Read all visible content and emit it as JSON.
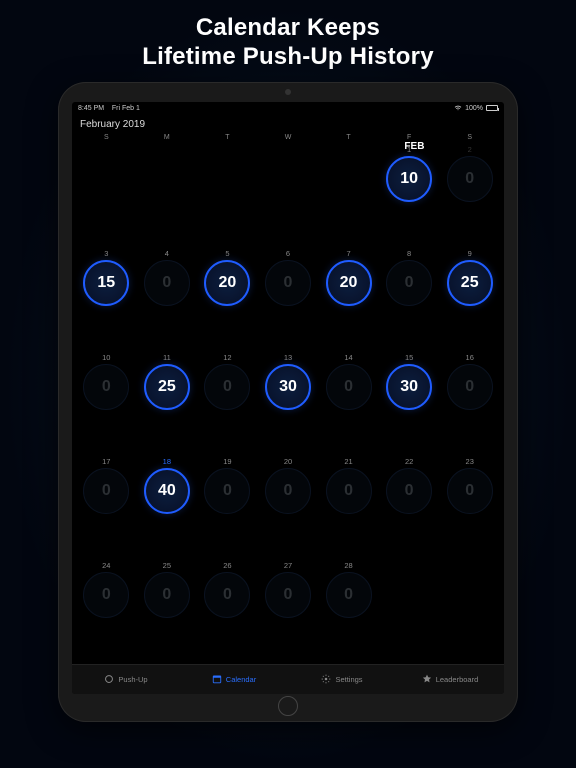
{
  "headline": {
    "line1": "Calendar Keeps",
    "line2": "Lifetime Push-Up History"
  },
  "statusbar": {
    "time": "8:45 PM",
    "date": "Fri Feb 1",
    "battery": "100%"
  },
  "month_title": "February 2019",
  "weekdays": [
    "S",
    "M",
    "T",
    "W",
    "T",
    "F",
    "S"
  ],
  "month_badge": "FEB",
  "today_day": 18,
  "days": [
    {
      "day": null,
      "value": null
    },
    {
      "day": null,
      "value": null
    },
    {
      "day": null,
      "value": null
    },
    {
      "day": null,
      "value": null
    },
    {
      "day": null,
      "value": null
    },
    {
      "day": 1,
      "value": 10
    },
    {
      "day": 2,
      "value": 0,
      "dim": true
    },
    {
      "day": 3,
      "value": 15
    },
    {
      "day": 4,
      "value": 0
    },
    {
      "day": 5,
      "value": 20
    },
    {
      "day": 6,
      "value": 0
    },
    {
      "day": 7,
      "value": 20
    },
    {
      "day": 8,
      "value": 0
    },
    {
      "day": 9,
      "value": 25
    },
    {
      "day": 10,
      "value": 0
    },
    {
      "day": 11,
      "value": 25
    },
    {
      "day": 12,
      "value": 0
    },
    {
      "day": 13,
      "value": 30
    },
    {
      "day": 14,
      "value": 0
    },
    {
      "day": 15,
      "value": 30
    },
    {
      "day": 16,
      "value": 0
    },
    {
      "day": 17,
      "value": 0
    },
    {
      "day": 18,
      "value": 40
    },
    {
      "day": 19,
      "value": 0
    },
    {
      "day": 20,
      "value": 0
    },
    {
      "day": 21,
      "value": 0
    },
    {
      "day": 22,
      "value": 0
    },
    {
      "day": 23,
      "value": 0
    },
    {
      "day": 24,
      "value": 0
    },
    {
      "day": 25,
      "value": 0
    },
    {
      "day": 26,
      "value": 0
    },
    {
      "day": 27,
      "value": 0
    },
    {
      "day": 28,
      "value": 0
    },
    {
      "day": null,
      "value": null
    },
    {
      "day": null,
      "value": null
    }
  ],
  "tabs": [
    {
      "id": "pushup",
      "label": "Push-Up",
      "active": false
    },
    {
      "id": "calendar",
      "label": "Calendar",
      "active": true
    },
    {
      "id": "settings",
      "label": "Settings",
      "active": false
    },
    {
      "id": "leaderboard",
      "label": "Leaderboard",
      "active": false
    }
  ]
}
